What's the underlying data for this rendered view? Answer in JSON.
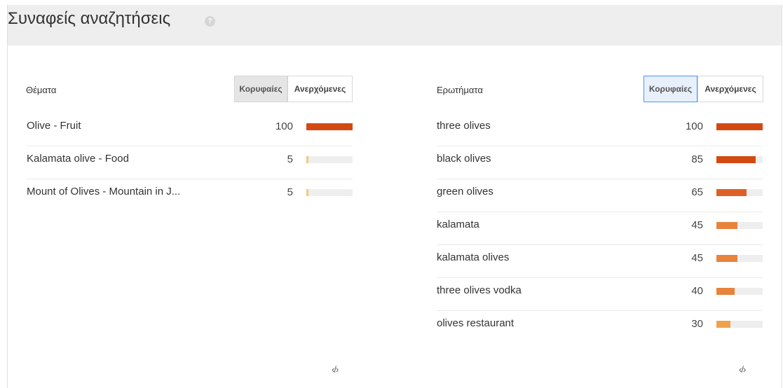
{
  "header": {
    "title": "Συναφείς αναζητήσεις",
    "help_icon": "?"
  },
  "topics": {
    "title": "Θέματα",
    "tabs": [
      {
        "label": "Κορυφαίες",
        "state": "active"
      },
      {
        "label": "Ανερχόμενες",
        "state": "normal"
      }
    ],
    "rows": [
      {
        "label": "Olive - Fruit",
        "value": "100",
        "level": 100,
        "color": "#d24a11"
      },
      {
        "label": "Kalamata olive - Food",
        "value": "5",
        "level": 5,
        "color": "#f7c979"
      },
      {
        "label": "Mount of Olives - Mountain in J...",
        "value": "5",
        "level": 5,
        "color": "#f7c979"
      }
    ],
    "embed_icon": "‹/›"
  },
  "queries": {
    "title": "Ερωτήματα",
    "tabs": [
      {
        "label": "Κορυφαίες",
        "state": "focused"
      },
      {
        "label": "Ανερχόμενες",
        "state": "normal"
      }
    ],
    "rows": [
      {
        "label": "three olives",
        "value": "100",
        "level": 100,
        "color": "#d24a11"
      },
      {
        "label": "black olives",
        "value": "85",
        "level": 85,
        "color": "#d24a11"
      },
      {
        "label": "green olives",
        "value": "65",
        "level": 65,
        "color": "#dd6026"
      },
      {
        "label": "kalamata",
        "value": "45",
        "level": 45,
        "color": "#e7833a"
      },
      {
        "label": "kalamata olives",
        "value": "45",
        "level": 45,
        "color": "#e7833a"
      },
      {
        "label": "three olives vodka",
        "value": "40",
        "level": 40,
        "color": "#e7833a"
      },
      {
        "label": "olives restaurant",
        "value": "30",
        "level": 30,
        "color": "#eea24e"
      }
    ],
    "embed_icon": "‹/›"
  }
}
